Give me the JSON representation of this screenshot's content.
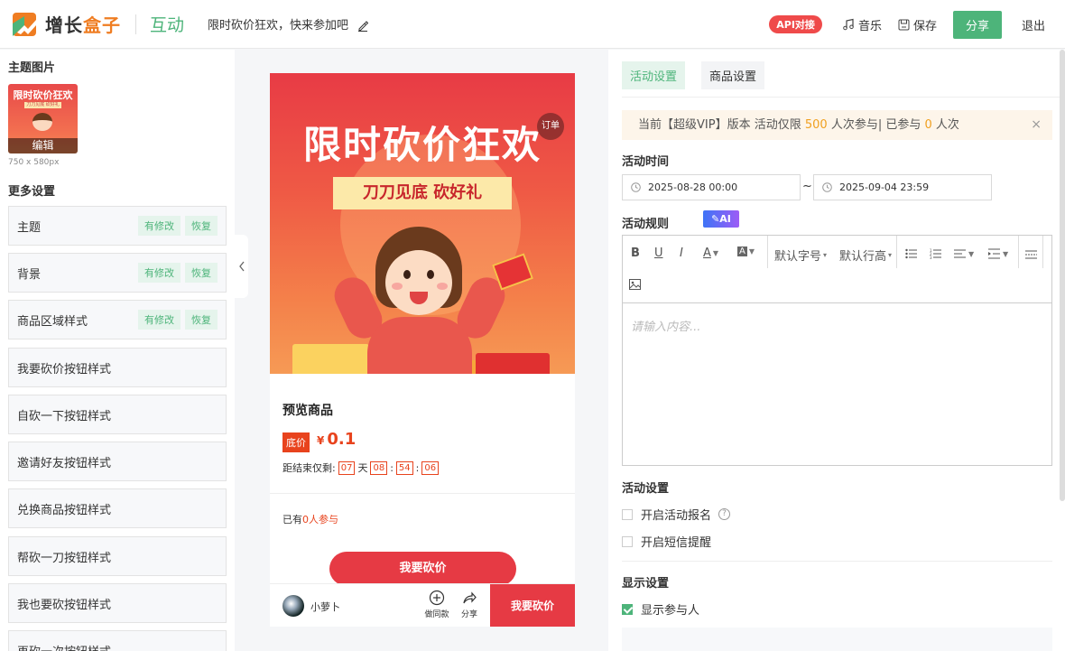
{
  "header": {
    "logo_text_a": "增长",
    "logo_text_b": "盒子",
    "module": "互动",
    "activity_title": "限时砍价狂欢，快来参加吧",
    "api_badge": "API对接",
    "music_label": "音乐",
    "save_label": "保存",
    "share_label": "分享",
    "exit_label": "退出"
  },
  "left": {
    "theme_image_title": "主题图片",
    "thumb_title": "限时砍价狂欢",
    "thumb_sub": "刀刀见底 砍好礼",
    "thumb_edit": "编辑",
    "image_size": "750 x 580px",
    "more_settings_title": "更多设置",
    "modified_tag": "有修改",
    "restore_tag": "恢复",
    "items": [
      {
        "label": "主题",
        "modified": true
      },
      {
        "label": "背景",
        "modified": true
      },
      {
        "label": "商品区域样式",
        "modified": true
      },
      {
        "label": "我要砍价按钮样式",
        "modified": false
      },
      {
        "label": "自砍一下按钮样式",
        "modified": false
      },
      {
        "label": "邀请好友按钮样式",
        "modified": false
      },
      {
        "label": "兑换商品按钮样式",
        "modified": false
      },
      {
        "label": "帮砍一刀按钮样式",
        "modified": false
      },
      {
        "label": "我也要砍按钮样式",
        "modified": false
      },
      {
        "label": "再砍一次按钮样式",
        "modified": false
      }
    ]
  },
  "preview": {
    "banner_title": "限时砍价狂欢",
    "banner_ribbon": "刀刀见底 砍好礼",
    "order_badge": "订单",
    "product_name": "预览商品",
    "low_price_tag": "底价",
    "currency": "¥",
    "price": "0.1",
    "countdown_label": "距结束仅剩:",
    "cd_days": "07",
    "cd_day_unit": "天",
    "cd_hours": "08",
    "cd_minutes": "54",
    "cd_seconds": "06",
    "cd_sep": ":",
    "joined_prefix": "已有",
    "joined_count": "0",
    "joined_suffix": "人参与",
    "main_button": "我要砍价",
    "nickname": "小萝卜",
    "same_style_label": "做同款",
    "share_label": "分享",
    "bottom_button": "我要砍价"
  },
  "right": {
    "tabs": [
      "活动设置",
      "商品设置"
    ],
    "notice_a": "当前【超级VIP】版本 活动仅限",
    "notice_limit": "500",
    "notice_b": "人次参与| 已参与",
    "notice_joined": "0",
    "notice_c": "人次",
    "notice_close": "×",
    "activity_time_label": "活动时间",
    "start_time": "2025-08-28 00:00",
    "end_time": "2025-09-04 23:59",
    "range_sep": "~",
    "rules_label": "活动规则",
    "ai_badge": "✎AI",
    "toolbar": {
      "bold": "B",
      "underline": "U",
      "italic": "I",
      "font_color": "A",
      "bg_color": "A",
      "font_size": "默认字号",
      "line_height": "默认行高"
    },
    "editor_placeholder": "请输入内容...",
    "activity_settings_label": "活动设置",
    "enable_signup": "开启活动报名",
    "enable_sms": "开启短信提醒",
    "display_settings_label": "显示设置",
    "show_participants": "显示参与人"
  },
  "colors": {
    "brand_green": "#4db47a",
    "brand_orange": "#ef7d22",
    "accent_red": "#e63a44",
    "price_orange": "#e8431d"
  }
}
